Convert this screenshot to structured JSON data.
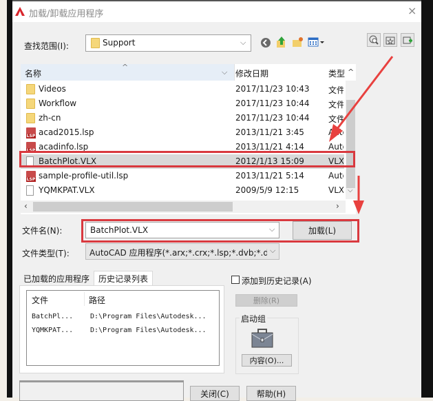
{
  "window": {
    "title": "加载/卸载应用程序",
    "close_label": "×"
  },
  "lookin": {
    "label": "查找范围(I):",
    "value": "Support"
  },
  "toolbar": {
    "back": "back-icon",
    "up": "up-folder-icon",
    "newfolder": "new-folder-icon",
    "views": "views-menu-icon"
  },
  "right_tools": [
    "search-web-icon",
    "favorites-icon",
    "add-favorite-icon"
  ],
  "filelist": {
    "columns": {
      "name": "名称",
      "date": "修改日期",
      "type": "类型"
    },
    "rows": [
      {
        "name": "Videos",
        "date": "2017/11/23 10:43",
        "type": "文件",
        "icon": "folder"
      },
      {
        "name": "Workflow",
        "date": "2017/11/23 10:44",
        "type": "文件",
        "icon": "folder"
      },
      {
        "name": "zh-cn",
        "date": "2017/11/23 10:44",
        "type": "文件",
        "icon": "folder"
      },
      {
        "name": "acad2015.lsp",
        "date": "2013/11/21 3:45",
        "type": "Autc",
        "icon": "lsp"
      },
      {
        "name": "acadinfo.lsp",
        "date": "2013/11/21 4:14",
        "type": "Autc",
        "icon": "lsp"
      },
      {
        "name": "BatchPlot.VLX",
        "date": "2012/1/13 15:09",
        "type": "VLX",
        "icon": "file",
        "selected": true
      },
      {
        "name": "sample-profile-util.lsp",
        "date": "2013/11/21 5:14",
        "type": "Autc",
        "icon": "lsp"
      },
      {
        "name": "YQMKPAT.VLX",
        "date": "2009/5/9 12:15",
        "type": "VLX",
        "icon": "file"
      }
    ]
  },
  "filename": {
    "label": "文件名(N):",
    "value": "BatchPlot.VLX"
  },
  "filetype": {
    "label": "文件类型(T):",
    "value": "AutoCAD 应用程序(*.arx;*.crx;*.lsp;*.dvb;*.dbx"
  },
  "load_button": "加载(L)",
  "tabs": [
    {
      "label": "已加载的应用程序"
    },
    {
      "label": "历史记录列表",
      "active": true
    }
  ],
  "history": {
    "columns": {
      "file": "文件",
      "path": "路径"
    },
    "rows": [
      {
        "file": "BatchPl...",
        "path": "D:\\Program Files\\Autodesk..."
      },
      {
        "file": "YQMKPAT...",
        "path": "D:\\Program Files\\Autodesk..."
      }
    ]
  },
  "add_history": {
    "label": "添加到历史记录(A)",
    "checked": false
  },
  "remove_button": "删除(R)",
  "startup": {
    "label": "启动组",
    "contents_button": "内容(O)..."
  },
  "close_button": "关闭(C)",
  "help_button": "帮助(H)",
  "colors": {
    "highlight": "#d9393f",
    "selected_row": "#d9d9d9"
  }
}
